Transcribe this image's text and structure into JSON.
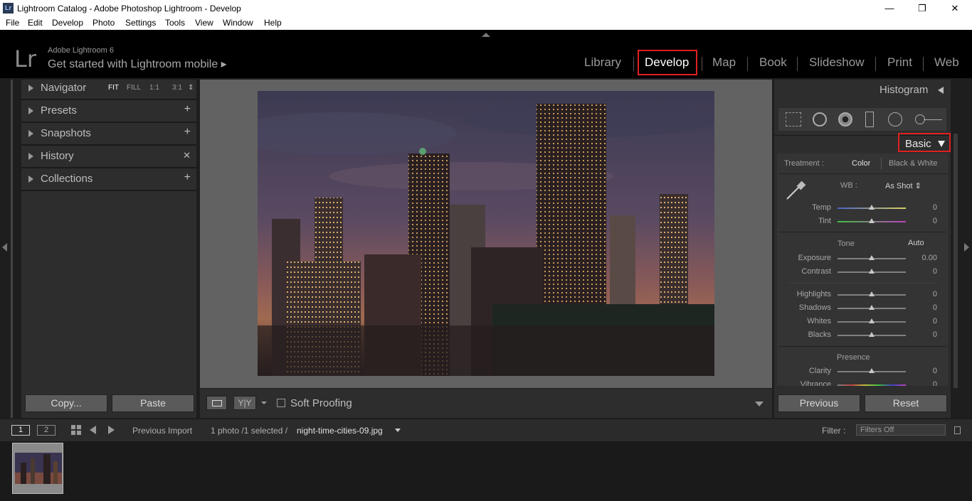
{
  "window": {
    "app_icon": "Lr",
    "title": "Lightroom Catalog - Adobe Photoshop Lightroom - Develop",
    "controls": [
      "minimize-icon",
      "restore-icon",
      "close-icon"
    ]
  },
  "menu": [
    "File",
    "Edit",
    "Develop",
    "Photo",
    "Settings",
    "Tools",
    "View",
    "Window",
    "Help"
  ],
  "identity": {
    "logo": "Lr",
    "line1": "Adobe Lightroom 6",
    "line2": "Get started with Lightroom mobile ▸"
  },
  "modules": [
    "Library",
    "Develop",
    "Map",
    "Book",
    "Slideshow",
    "Print",
    "Web"
  ],
  "active_module": "Develop",
  "left_panel": {
    "navigator": {
      "label": "Navigator",
      "options": [
        "FIT",
        "FILL",
        "1:1",
        "3:1"
      ],
      "selected": "FIT",
      "spinner": "⇕"
    },
    "presets": {
      "label": "Presets",
      "action": "+"
    },
    "snapshots": {
      "label": "Snapshots",
      "action": "+"
    },
    "history": {
      "label": "History",
      "action": "✕"
    },
    "collections": {
      "label": "Collections",
      "action": "+"
    },
    "copy_label": "Copy...",
    "paste_label": "Paste"
  },
  "toolbar": {
    "view_icon": "loupe-view-icon",
    "before_after_label": "Y|Y",
    "soft_proofing_label": "Soft Proofing",
    "soft_proofing_checked": false
  },
  "right_panel": {
    "histogram_label": "Histogram",
    "basic_label": "Basic",
    "treatment_label": "Treatment :",
    "treatment_color": "Color",
    "treatment_bw": "Black & White",
    "wb_label": "WB :",
    "wb_value": "As Shot",
    "temp_label": "Temp",
    "temp_value": "0",
    "tint_label": "Tint",
    "tint_value": "0",
    "tone_label": "Tone",
    "auto_label": "Auto",
    "exposure_label": "Exposure",
    "exposure_value": "0.00",
    "contrast_label": "Contrast",
    "contrast_value": "0",
    "highlights_label": "Highlights",
    "highlights_value": "0",
    "shadows_label": "Shadows",
    "shadows_value": "0",
    "whites_label": "Whites",
    "whites_value": "0",
    "blacks_label": "Blacks",
    "blacks_value": "0",
    "presence_label": "Presence",
    "clarity_label": "Clarity",
    "clarity_value": "0",
    "vibrance_label": "Vibrance",
    "vibrance_value": "0",
    "previous_label": "Previous",
    "reset_label": "Reset"
  },
  "filmstrip": {
    "page1": "1",
    "page2": "2",
    "source": "Previous Import",
    "count": "1 photo /1 selected /",
    "filename": "night-time-cities-09.jpg",
    "filter_label": "Filter :",
    "filter_value": "Filters Off"
  },
  "colors": {
    "highlight_box": "#e02020",
    "panel_bg": "#2d2d2d",
    "canvas_bg": "#626262"
  }
}
